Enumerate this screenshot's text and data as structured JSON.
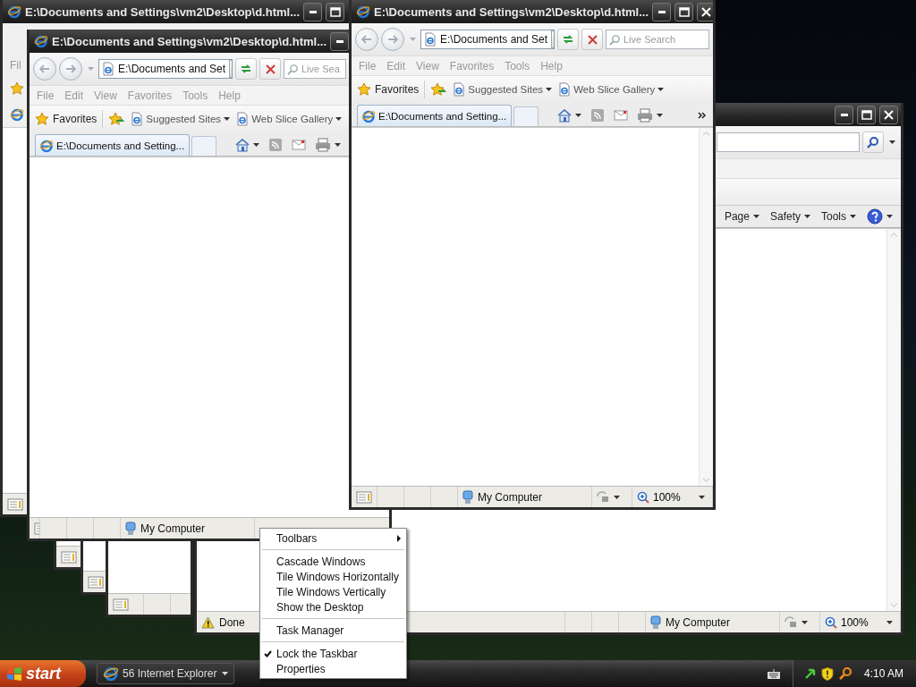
{
  "windows": [
    {
      "kind": "partial",
      "title": "E:\\Documents and Settings\\vm2\\Desktop\\d.html...",
      "menu": [
        "Fil"
      ]
    },
    {
      "kind": "browser",
      "title": "E:\\Documents and Settings\\vm2\\Desktop\\d.html...",
      "address": "E:\\Documents and Set",
      "search_placeholder": "Live Sea",
      "menu": [
        "File",
        "Edit",
        "View",
        "Favorites",
        "Tools",
        "Help"
      ],
      "favorites": "Favorites",
      "links": [
        "Suggested Sites",
        "Web Slice Gallery"
      ],
      "tab": {
        "label": "E:\\Documents and Setting...",
        "selected": true
      },
      "status": {
        "zone": "My Computer"
      }
    },
    {
      "kind": "browser",
      "title": "E:\\Documents and Settings\\vm2\\Desktop\\d.html...",
      "address": "E:\\Documents and Set",
      "search_placeholder": "Live Search",
      "menu": [
        "File",
        "Edit",
        "View",
        "Favorites",
        "Tools",
        "Help"
      ],
      "favorites": "Favorites",
      "links": [
        "Suggested Sites",
        "Web Slice Gallery"
      ],
      "tab": {
        "label": "E:\\Documents and Setting...",
        "selected": true
      },
      "status": {
        "zone": "My Computer",
        "zoom": "100%"
      }
    },
    {
      "kind": "browser",
      "commands": [
        "Page",
        "Safety",
        "Tools"
      ],
      "status": {
        "message": "Done",
        "zone": "My Computer",
        "zoom": "100%"
      }
    },
    {
      "kind": "stub"
    },
    {
      "kind": "stub"
    },
    {
      "kind": "stub"
    }
  ],
  "context_menu": [
    {
      "kind": "submenu",
      "label": "Toolbars"
    },
    {
      "kind": "separator"
    },
    {
      "kind": "item",
      "label": "Cascade Windows"
    },
    {
      "kind": "item",
      "label": "Tile Windows Horizontally"
    },
    {
      "kind": "item",
      "label": "Tile Windows Vertically"
    },
    {
      "kind": "item",
      "label": "Show the Desktop"
    },
    {
      "kind": "separator"
    },
    {
      "kind": "item",
      "label": "Task Manager"
    },
    {
      "kind": "separator"
    },
    {
      "kind": "check",
      "label": "Lock the Taskbar",
      "checked": true
    },
    {
      "kind": "item",
      "label": "Properties"
    }
  ],
  "taskbar": {
    "start": "start",
    "tasks": [
      {
        "label": "56 Internet Explorer"
      }
    ],
    "clock": "4:10 AM"
  }
}
